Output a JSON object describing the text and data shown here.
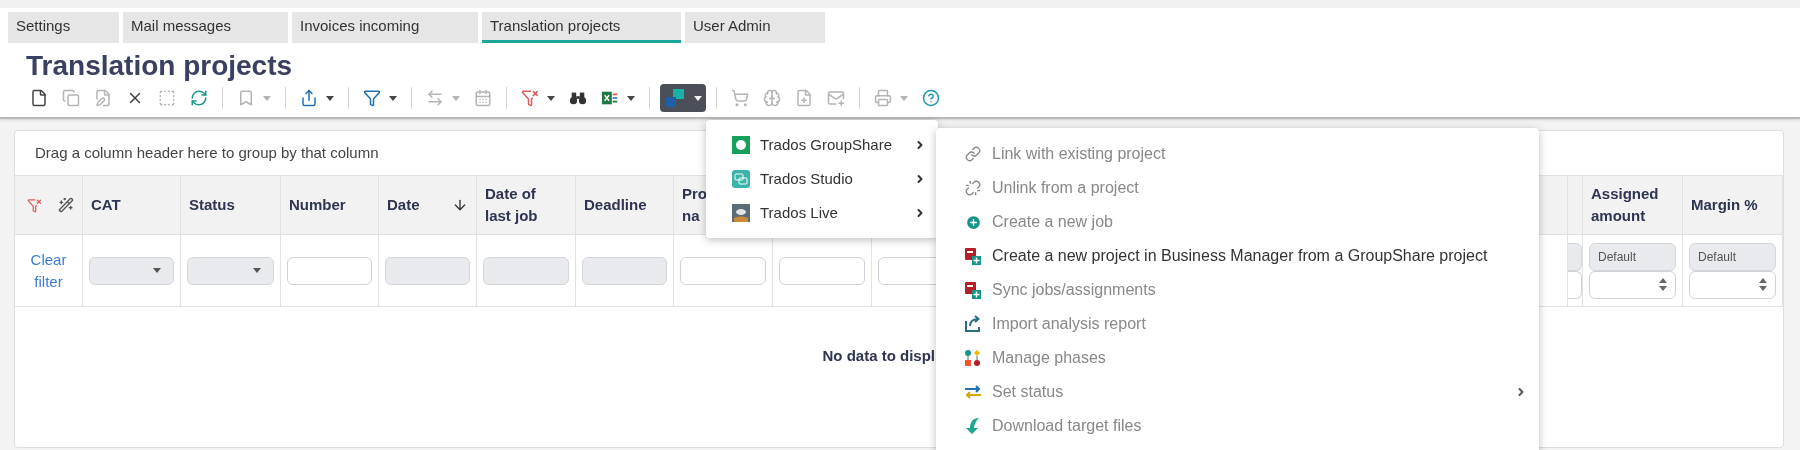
{
  "tabs": [
    {
      "label": "Settings",
      "selected": false
    },
    {
      "label": "Mail messages",
      "selected": false
    },
    {
      "label": "Invoices incoming",
      "selected": false
    },
    {
      "label": "Translation projects",
      "selected": true
    },
    {
      "label": "User Admin",
      "selected": false
    }
  ],
  "page_title": "Translation projects",
  "toolbar": [
    {
      "disabled": false,
      "dropdown": false
    },
    {
      "disabled": true,
      "dropdown": false
    },
    {
      "disabled": true,
      "dropdown": false
    },
    {
      "disabled": false,
      "dropdown": false
    },
    {
      "disabled": true,
      "dropdown": false
    },
    {
      "disabled": false,
      "dropdown": false
    },
    {
      "disabled": true,
      "dropdown": true
    },
    {
      "disabled": false,
      "dropdown": true
    },
    {
      "disabled": false,
      "dropdown": true
    },
    {
      "disabled": true,
      "dropdown": true
    },
    {
      "disabled": true,
      "dropdown": false
    },
    {
      "disabled": false,
      "dropdown": true
    },
    {
      "disabled": false,
      "dropdown": false
    },
    {
      "disabled": false,
      "dropdown": true
    },
    {
      "disabled": false,
      "dropdown": true,
      "open": true
    },
    {
      "disabled": true,
      "dropdown": false
    },
    {
      "disabled": true,
      "dropdown": false
    },
    {
      "disabled": true,
      "dropdown": false
    },
    {
      "disabled": true,
      "dropdown": false
    },
    {
      "disabled": true,
      "dropdown": true
    },
    {
      "disabled": false,
      "dropdown": false
    }
  ],
  "group_hint": "Drag a column header here to group by that column",
  "table": {
    "columns": [
      {
        "kind": "clear",
        "filter_label": "Clear filter"
      },
      {
        "kind": "select",
        "lines": [
          "CAT"
        ]
      },
      {
        "kind": "select",
        "lines": [
          "Status"
        ]
      },
      {
        "kind": "text",
        "lines": [
          "Number"
        ]
      },
      {
        "kind": "date",
        "lines": [
          "Date"
        ],
        "sort_descending": true
      },
      {
        "kind": "date",
        "lines": [
          "Date of",
          "last job"
        ]
      },
      {
        "kind": "date",
        "lines": [
          "Deadline"
        ]
      },
      {
        "kind": "text",
        "lines": [
          "Pro",
          "na"
        ]
      },
      {
        "kind": "text"
      },
      {
        "kind": "text"
      },
      {
        "kind": "gap"
      },
      {
        "kind": "amount"
      },
      {
        "kind": "amount",
        "lines": [
          "Assigned",
          "amount"
        ],
        "filter_value": "Default"
      },
      {
        "kind": "amount",
        "lines": [
          "Margin %"
        ],
        "filter_value": "Default"
      }
    ],
    "empty_text": "No data to displ"
  },
  "menu": {
    "items": [
      {
        "label": "Trados GroupShare",
        "has_submenu": true
      },
      {
        "label": "Trados Studio",
        "has_submenu": true
      },
      {
        "label": "Trados Live",
        "has_submenu": true
      }
    ]
  },
  "submenu": {
    "items": [
      {
        "label": "Link with existing project",
        "disabled": true,
        "has_submenu": false
      },
      {
        "label": "Unlink from a project",
        "disabled": true,
        "has_submenu": false
      },
      {
        "label": "Create a new job",
        "disabled": true,
        "has_submenu": false
      },
      {
        "label": "Create a new project in Business Manager from a GroupShare project",
        "disabled": false,
        "has_submenu": false
      },
      {
        "label": "Sync jobs/assignments",
        "disabled": true,
        "has_submenu": false
      },
      {
        "label": "Import analysis report",
        "disabled": true,
        "has_submenu": false
      },
      {
        "label": "Manage phases",
        "disabled": true,
        "has_submenu": false
      },
      {
        "label": "Set status",
        "disabled": true,
        "has_submenu": true
      },
      {
        "label": "Download target files",
        "disabled": true,
        "has_submenu": false
      }
    ]
  }
}
